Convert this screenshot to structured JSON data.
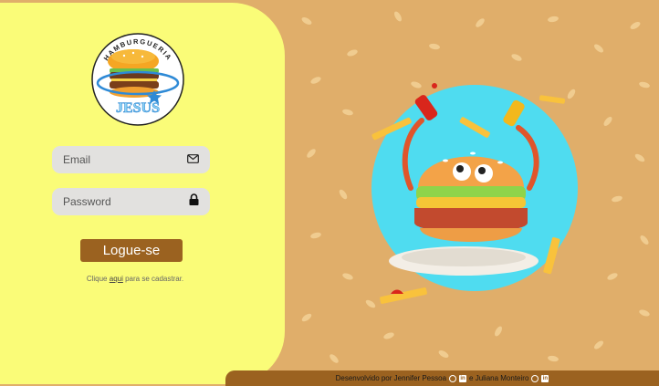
{
  "logo": {
    "top_text": "HAMBURGUERIA",
    "bottom_text": "JESUS"
  },
  "login": {
    "email_placeholder": "Email",
    "email_icon": "envelope-icon",
    "password_placeholder": "Password",
    "password_icon": "lock-icon",
    "button_label": "Logue-se",
    "signup_prefix": "Clique",
    "signup_link": "aqui",
    "signup_suffix": "para se cadastrar."
  },
  "footer": {
    "prefix": "Desenvolvido por Jennifer Pessoa",
    "middle": "e Juliana Monteiro",
    "icons": [
      "github-icon",
      "linkedin-icon"
    ]
  },
  "colors": {
    "left_panel": "#fafc78",
    "background": "#e0ae6a",
    "accent": "#9b6220",
    "illustration_circle": "#4fdcf0"
  }
}
